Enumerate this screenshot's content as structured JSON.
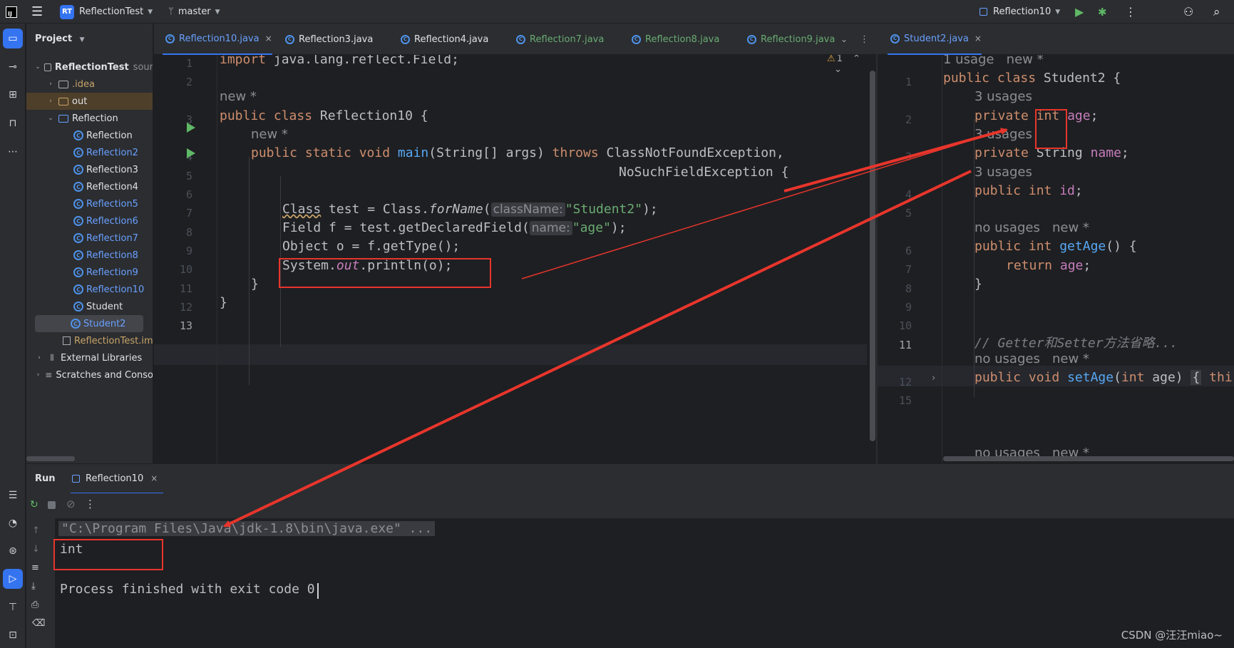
{
  "titlebar": {
    "project_badge": "RT",
    "project_name": "ReflectionTest",
    "branch": "master",
    "run_config": "Reflection10"
  },
  "project_panel": {
    "header": "Project",
    "tree": [
      {
        "label": "ReflectionTest",
        "suffix": "sour",
        "level": 0
      },
      {
        "label": ".idea",
        "level": 1
      },
      {
        "label": "out",
        "level": 1
      },
      {
        "label": "Reflection",
        "level": 1
      },
      {
        "label": "Reflection",
        "level": 2
      },
      {
        "label": "Reflection2",
        "level": 2
      },
      {
        "label": "Reflection3",
        "level": 2
      },
      {
        "label": "Reflection4",
        "level": 2
      },
      {
        "label": "Reflection5",
        "level": 2
      },
      {
        "label": "Reflection6",
        "level": 2
      },
      {
        "label": "Reflection7",
        "level": 2
      },
      {
        "label": "Reflection8",
        "level": 2
      },
      {
        "label": "Reflection9",
        "level": 2
      },
      {
        "label": "Reflection10",
        "level": 2
      },
      {
        "label": "Student",
        "level": 2
      },
      {
        "label": "Student2",
        "level": 2
      },
      {
        "label": "ReflectionTest.im",
        "level": 1
      },
      {
        "label": "External Libraries",
        "level": 0
      },
      {
        "label": "Scratches and Conso",
        "level": 0
      }
    ]
  },
  "tabs_left": [
    {
      "label": "Reflection10.java",
      "close": "×"
    },
    {
      "label": "Reflection3.java"
    },
    {
      "label": "Reflection4.java"
    },
    {
      "label": "Reflection7.java"
    },
    {
      "label": "Reflection8.java"
    },
    {
      "label": "Reflection9.java"
    }
  ],
  "tabs_right": [
    {
      "label": "Student2.java",
      "close": "×"
    }
  ],
  "editor_left": {
    "warning_count": "1",
    "line_numbers": [
      "1",
      "2",
      "3",
      "4",
      "5",
      "6",
      "7",
      "8",
      "9",
      "10",
      "11",
      "12",
      "13"
    ],
    "import_kw": "import",
    "import_rest": " java.lang.reflect.Field;",
    "hint_new": "new *",
    "public_class": "public class",
    "class_name": " Reflection10 {",
    "hint_new2": "new *",
    "main_kw": "public static void",
    "main_fn": "main",
    "main_params": "(String[] args) ",
    "throws_kw": "throws",
    "throws_rest": " ClassNotFoundException,",
    "throws_rest2": "NoSuchFieldException {",
    "l7_class": "Class",
    "l7_a": " test = Class.",
    "l7_forname": "forName",
    "l7_b": "(",
    "l7_param": "className:",
    "l7_str": "\"Student2\"",
    "l7_c": ");",
    "l8_a": "Field f = test.getDeclaredField(",
    "l8_param": "name:",
    "l8_str": "\"age\"",
    "l8_c": ");",
    "l9": "Object o = f.getType();",
    "l10_a": "System.",
    "l10_out": "out",
    "l10_b": ".println(o);",
    "l11": "}",
    "l12": "}"
  },
  "editor_right": {
    "line_numbers": [
      "1",
      "2",
      "3",
      "4",
      "5",
      "6",
      "7",
      "8",
      "9",
      "10",
      "11",
      "12",
      "15"
    ],
    "hint_usage": "1 usage   new *",
    "class_kw": "public class",
    "class_rest": " Student2 {",
    "hint_3usages_a": "3 usages",
    "age_kw": "private",
    "age_type": "int",
    "age_fld": "age",
    "semi": ";",
    "hint_3usages_b": "3 usages",
    "name_kw": "private",
    "name_type": " String ",
    "name_fld": "name",
    "hint_3usages_c": "3 usages",
    "id_kw": "public int",
    "id_fld": "id",
    "hint_nousages_a": "no usages   new *",
    "getage_kw": "public int",
    "getage_fn": "getAge",
    "getage_rest": "() {",
    "return_kw": "return",
    "return_fld": "age",
    "close_brace": "}",
    "comment": "// Getter和Setter方法省略...",
    "hint_nousages_b": "no usages   new *",
    "setage_kw": "public void",
    "setage_fn": "setAge",
    "setage_a": "(",
    "setage_int": "int",
    "setage_b": " age) ",
    "setage_fold": "{",
    "setage_this": " thi",
    "hint_nousages_c": "no usages   new *"
  },
  "run_panel": {
    "title": "Run",
    "tab": "Reflection10",
    "tab_close": "×"
  },
  "console": {
    "cmd": "\"C:\\Program Files\\Java\\jdk-1.8\\bin\\java.exe\" ...",
    "output": "int",
    "exit": "Process finished with exit code 0"
  },
  "watermark": "CSDN @汪汪miao~",
  "colors": {
    "annotation_red": "#e8352c",
    "accent_blue": "#3574f0",
    "keyword": "#cf8e6d",
    "string": "#6aab73",
    "field": "#c77dbb",
    "function": "#56a8f5"
  }
}
